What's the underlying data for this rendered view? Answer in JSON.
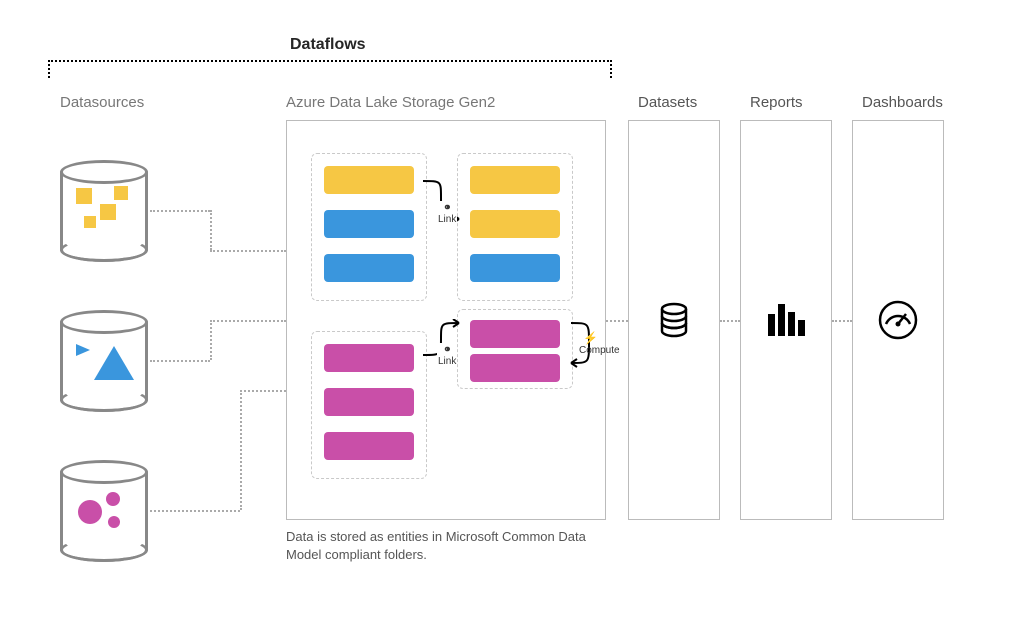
{
  "title": "Dataflows",
  "columns": {
    "datasources": "Datasources",
    "adls": "Azure Data Lake Storage Gen2",
    "datasets": "Datasets",
    "reports": "Reports",
    "dashboards": "Dashboards"
  },
  "labels": {
    "link": "Link",
    "compute": "Compute"
  },
  "caption": "Data is stored as entities in Microsoft Common Data Model compliant folders."
}
